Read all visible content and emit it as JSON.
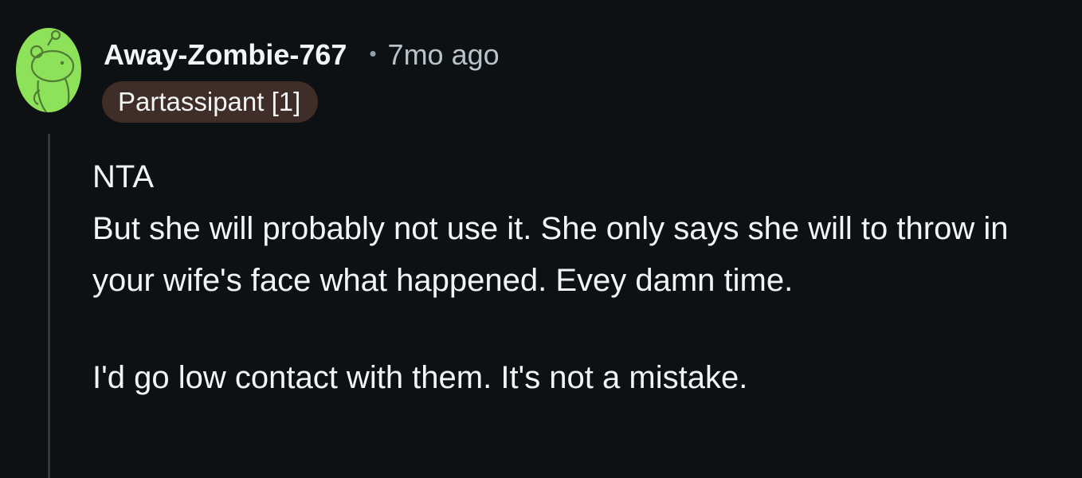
{
  "comment": {
    "author": "Away-Zombie-767",
    "separator": "•",
    "timestamp": "7mo ago",
    "flair": "Partassipant [1]",
    "avatar_icon": "snoo-avatar-icon",
    "body": {
      "lines": [
        "NTA",
        "But she will probably not use it. She only says she will to throw in your wife's face what happened. Evey damn time.",
        "I'd go low contact with them. It's not a mistake."
      ]
    }
  },
  "colors": {
    "background": "#0e1113",
    "avatar_green": "#8ee25a",
    "flair_bg": "#3e2e27",
    "text": "#f2f4f5",
    "meta_text": "#b7c4cc",
    "thread_line": "#33393c"
  }
}
